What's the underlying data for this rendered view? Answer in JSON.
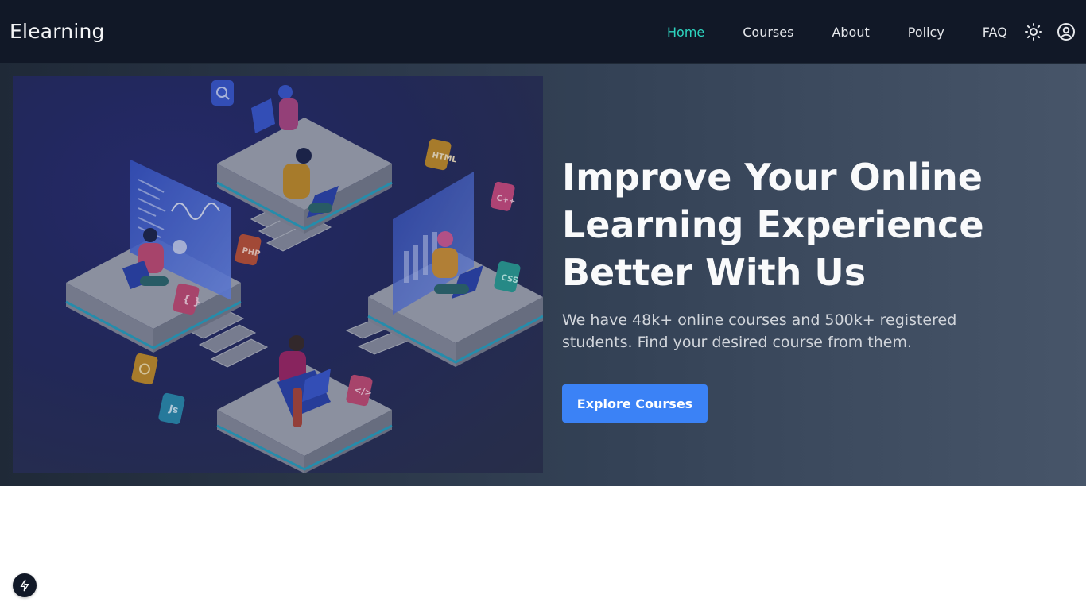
{
  "header": {
    "brand": "Elearning",
    "nav": [
      "Home",
      "Courses",
      "About",
      "Policy",
      "FAQ"
    ],
    "active_index": 0,
    "icons": [
      "sun-icon",
      "user-account-icon"
    ]
  },
  "hero": {
    "title": "Improve Your Online Learning Experience Better With Us",
    "subtitle": "We have 48k+ online courses and 500k+ registered students. Find your desired course from them.",
    "cta_label": "Explore Courses",
    "illustration": {
      "badges": [
        "HTML",
        "C++",
        "PHP",
        "CSS",
        "{ }",
        "Js",
        "</>"
      ],
      "icon_badges": [
        "search-icon",
        "settings-gear-icon"
      ]
    }
  },
  "floating": {
    "icon": "lightning-bolt-icon"
  },
  "colors": {
    "nav_bg": "#111827",
    "active_link": "#2dd4bf",
    "hero_bg_start": "#1f2937",
    "hero_bg_end": "#475569",
    "cta_bg": "#3b82f6"
  }
}
